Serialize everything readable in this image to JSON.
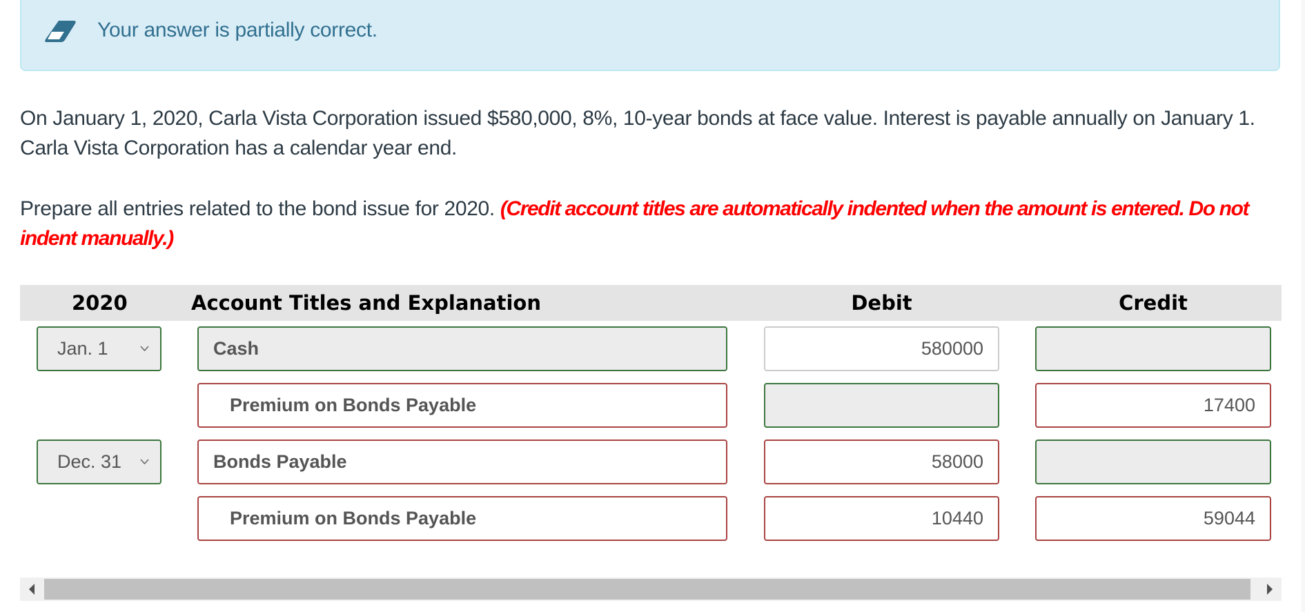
{
  "feedback": {
    "icon": "eraser-icon",
    "message": "Your answer is partially correct.",
    "colors": {
      "background": "#d9edf7",
      "border": "#bce8f1",
      "text": "#31708f"
    }
  },
  "problem": {
    "paragraph1": "On January 1, 2020, Carla Vista Corporation issued $580,000, 8%, 10-year bonds at face value. Interest is payable annually on January 1. Carla Vista Corporation has a calendar year end.",
    "paragraph2_text": "Prepare all entries related to the bond issue for 2020.",
    "paragraph2_instruction": "(Credit account titles are automatically indented when the amount is entered. Do not indent manually.)"
  },
  "table": {
    "headers": {
      "date": "2020",
      "account": "Account Titles and Explanation",
      "debit": "Debit",
      "credit": "Credit"
    },
    "rows": [
      {
        "date": "Jan. 1",
        "date_status": "correct",
        "account": "Cash",
        "account_status": "correct",
        "account_indented": false,
        "debit": "580000",
        "debit_status": "neutral",
        "credit": "",
        "credit_status": "correct"
      },
      {
        "date": "",
        "date_status": "",
        "account": "Premium on Bonds Payable",
        "account_status": "incorrect",
        "account_indented": true,
        "debit": "",
        "debit_status": "correct",
        "credit": "17400",
        "credit_status": "incorrect"
      },
      {
        "date": "Dec. 31",
        "date_status": "correct",
        "account": "Bonds Payable",
        "account_status": "incorrect",
        "account_indented": false,
        "debit": "58000",
        "debit_status": "incorrect",
        "credit": "",
        "credit_status": "correct"
      },
      {
        "date": "",
        "date_status": "",
        "account": "Premium on Bonds Payable",
        "account_status": "incorrect",
        "account_indented": true,
        "debit": "10440",
        "debit_status": "incorrect",
        "credit": "59044",
        "credit_status": "incorrect"
      }
    ],
    "status_colors": {
      "correct": "#3c763d",
      "incorrect": "#a94442",
      "neutral": "#cccccc"
    }
  },
  "scrollbar": {
    "left_arrow": "scroll-left-icon",
    "right_arrow": "scroll-right-icon"
  }
}
